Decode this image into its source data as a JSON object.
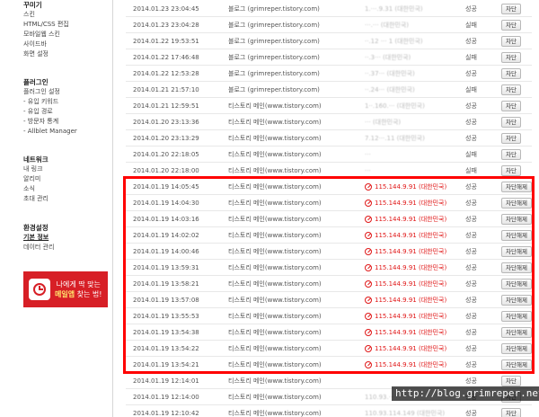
{
  "sidebar": {
    "sections": [
      {
        "heading": "꾸미기",
        "items": [
          "스킨",
          "HTML/CSS 편집",
          "모바일웹 스킨",
          "사이드바",
          "화면 설정"
        ]
      },
      {
        "heading": "플러그인",
        "items": [
          "플러그인 설정",
          "- 유입 키워드",
          "- 유입 경로",
          "- 방문자 통계",
          "- Allblet Manager"
        ]
      },
      {
        "heading": "네트워크",
        "items": [
          "내 링크",
          "알리미",
          "소식",
          "초대 관리"
        ]
      },
      {
        "heading": "환경설정",
        "items": [
          "기본 정보",
          "데이터 관리"
        ]
      }
    ],
    "ad": {
      "line1": "나에게 딱 맞는",
      "line2_highlight": "메일앱",
      "line2_rest": " 찾는 법!"
    }
  },
  "log": {
    "rows": [
      {
        "date": "2014.01.23 23:04:45",
        "referrer": "블로그 (grimreper.tistory.com)",
        "ip": "1.···.9.31 (대한민국)",
        "result": "성공",
        "action": "차단",
        "blocked": false
      },
      {
        "date": "2014.01.23 23:04:28",
        "referrer": "블로그 (grimreper.tistory.com)",
        "ip": "···.··· (대한민국)",
        "result": "실패",
        "action": "차단",
        "blocked": false
      },
      {
        "date": "2014.01.22 19:53:51",
        "referrer": "블로그 (grimreper.tistory.com)",
        "ip": "··.12 ··· 1 (대한민국)",
        "result": "성공",
        "action": "차단",
        "blocked": false
      },
      {
        "date": "2014.01.22 17:46:48",
        "referrer": "블로그 (grimreper.tistory.com)",
        "ip": "··.3··· (대한민국)",
        "result": "실패",
        "action": "차단",
        "blocked": false
      },
      {
        "date": "2014.01.22 12:53:28",
        "referrer": "블로그 (grimreper.tistory.com)",
        "ip": "··.37··· (대한민국)",
        "result": "성공",
        "action": "차단",
        "blocked": false
      },
      {
        "date": "2014.01.21 21:57:10",
        "referrer": "블로그 (grimreper.tistory.com)",
        "ip": "··.24··· (대한민국)",
        "result": "실패",
        "action": "차단",
        "blocked": false
      },
      {
        "date": "2014.01.21 12:59:51",
        "referrer": "티스토리 메인(www.tistory.com)",
        "ip": "1··.160.··· (대한민국)",
        "result": "성공",
        "action": "차단",
        "blocked": false
      },
      {
        "date": "2014.01.20 23:13:36",
        "referrer": "티스토리 메인(www.tistory.com)",
        "ip": "··· (대한민국)",
        "result": "성공",
        "action": "차단",
        "blocked": false
      },
      {
        "date": "2014.01.20 23:13:29",
        "referrer": "티스토리 메인(www.tistory.com)",
        "ip": "7.12···.11 (대한민국)",
        "result": "성공",
        "action": "차단",
        "blocked": false
      },
      {
        "date": "2014.01.20 22:18:05",
        "referrer": "티스토리 메인(www.tistory.com)",
        "ip": "···",
        "result": "실패",
        "action": "차단",
        "blocked": false
      },
      {
        "date": "2014.01.20 22:18:00",
        "referrer": "티스토리 메인(www.tistory.com)",
        "ip": "···",
        "result": "실패",
        "action": "차단",
        "blocked": false
      },
      {
        "date": "2014.01.19 14:05:45",
        "referrer": "티스토리 메인(www.tistory.com)",
        "ip": "115.144.9.91 (대한민국)",
        "result": "성공",
        "action": "차단해제",
        "blocked": true
      },
      {
        "date": "2014.01.19 14:04:30",
        "referrer": "티스토리 메인(www.tistory.com)",
        "ip": "115.144.9.91 (대한민국)",
        "result": "성공",
        "action": "차단해제",
        "blocked": true
      },
      {
        "date": "2014.01.19 14:03:16",
        "referrer": "티스토리 메인(www.tistory.com)",
        "ip": "115.144.9.91 (대한민국)",
        "result": "성공",
        "action": "차단해제",
        "blocked": true
      },
      {
        "date": "2014.01.19 14:02:02",
        "referrer": "티스토리 메인(www.tistory.com)",
        "ip": "115.144.9.91 (대한민국)",
        "result": "성공",
        "action": "차단해제",
        "blocked": true
      },
      {
        "date": "2014.01.19 14:00:46",
        "referrer": "티스토리 메인(www.tistory.com)",
        "ip": "115.144.9.91 (대한민국)",
        "result": "성공",
        "action": "차단해제",
        "blocked": true
      },
      {
        "date": "2014.01.19 13:59:31",
        "referrer": "티스토리 메인(www.tistory.com)",
        "ip": "115.144.9.91 (대한민국)",
        "result": "성공",
        "action": "차단해제",
        "blocked": true
      },
      {
        "date": "2014.01.19 13:58:21",
        "referrer": "티스토리 메인(www.tistory.com)",
        "ip": "115.144.9.91 (대한민국)",
        "result": "성공",
        "action": "차단해제",
        "blocked": true
      },
      {
        "date": "2014.01.19 13:57:08",
        "referrer": "티스토리 메인(www.tistory.com)",
        "ip": "115.144.9.91 (대한민국)",
        "result": "성공",
        "action": "차단해제",
        "blocked": true
      },
      {
        "date": "2014.01.19 13:55:53",
        "referrer": "티스토리 메인(www.tistory.com)",
        "ip": "115.144.9.91 (대한민국)",
        "result": "성공",
        "action": "차단해제",
        "blocked": true
      },
      {
        "date": "2014.01.19 13:54:38",
        "referrer": "티스토리 메인(www.tistory.com)",
        "ip": "115.144.9.91 (대한민국)",
        "result": "성공",
        "action": "차단해제",
        "blocked": true
      },
      {
        "date": "2014.01.19 13:54:22",
        "referrer": "티스토리 메인(www.tistory.com)",
        "ip": "115.144.9.91 (대한민국)",
        "result": "성공",
        "action": "차단해제",
        "blocked": true
      },
      {
        "date": "2014.01.19 13:54:21",
        "referrer": "티스토리 메인(www.tistory.com)",
        "ip": "115.144.9.91 (대한민국)",
        "result": "성공",
        "action": "차단해제",
        "blocked": true
      },
      {
        "date": "2014.01.19 12:14:01",
        "referrer": "티스토리 메인(www.tistory.com)",
        "ip": "",
        "result": "성공",
        "action": "차단",
        "blocked": false
      },
      {
        "date": "2014.01.19 12:14:00",
        "referrer": "티스토리 메인(www.tistory.com)",
        "ip": "110.93.···",
        "result": "성공",
        "action": "차단",
        "blocked": false
      },
      {
        "date": "2014.01.19 12:10:42",
        "referrer": "티스토리 메인(www.tistory.com)",
        "ip": "110.93.114.149 (대한민국)",
        "result": "성공",
        "action": "차단",
        "blocked": false
      }
    ]
  },
  "watermark": "http://blog.grimreper.net",
  "colors": {
    "highlight": "#ff0000",
    "blocked_ip": "#e01818",
    "ad_background": "#d71f26"
  }
}
